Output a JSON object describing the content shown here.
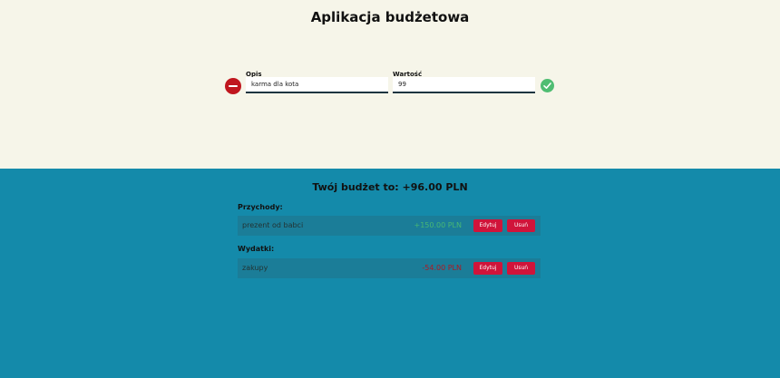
{
  "header": {
    "title": "Aplikacja budżetowa"
  },
  "form": {
    "description_label": "Opis",
    "description_value": "karma dla kota",
    "value_label": "Wartość",
    "value_value": "99"
  },
  "budget": {
    "title": "Twój budżet to: +96.00 PLN"
  },
  "income": {
    "label": "Przychody:",
    "items": [
      {
        "description": "prezent od babci",
        "amount": "+150.00 PLN",
        "edit_label": "Edytuj",
        "delete_label": "Usuń"
      }
    ]
  },
  "expenses": {
    "label": "Wydatki:",
    "items": [
      {
        "description": "zakupy",
        "amount": "-54.00 PLN",
        "edit_label": "Edytuj",
        "delete_label": "Usuń"
      }
    ]
  },
  "colors": {
    "top_background": "#f6f5e9",
    "bottom_background": "#148aaa",
    "income": "#48b874",
    "expense": "#b01822",
    "button": "#d0143a",
    "minus": "#c0161e",
    "check": "#4fbd72"
  }
}
